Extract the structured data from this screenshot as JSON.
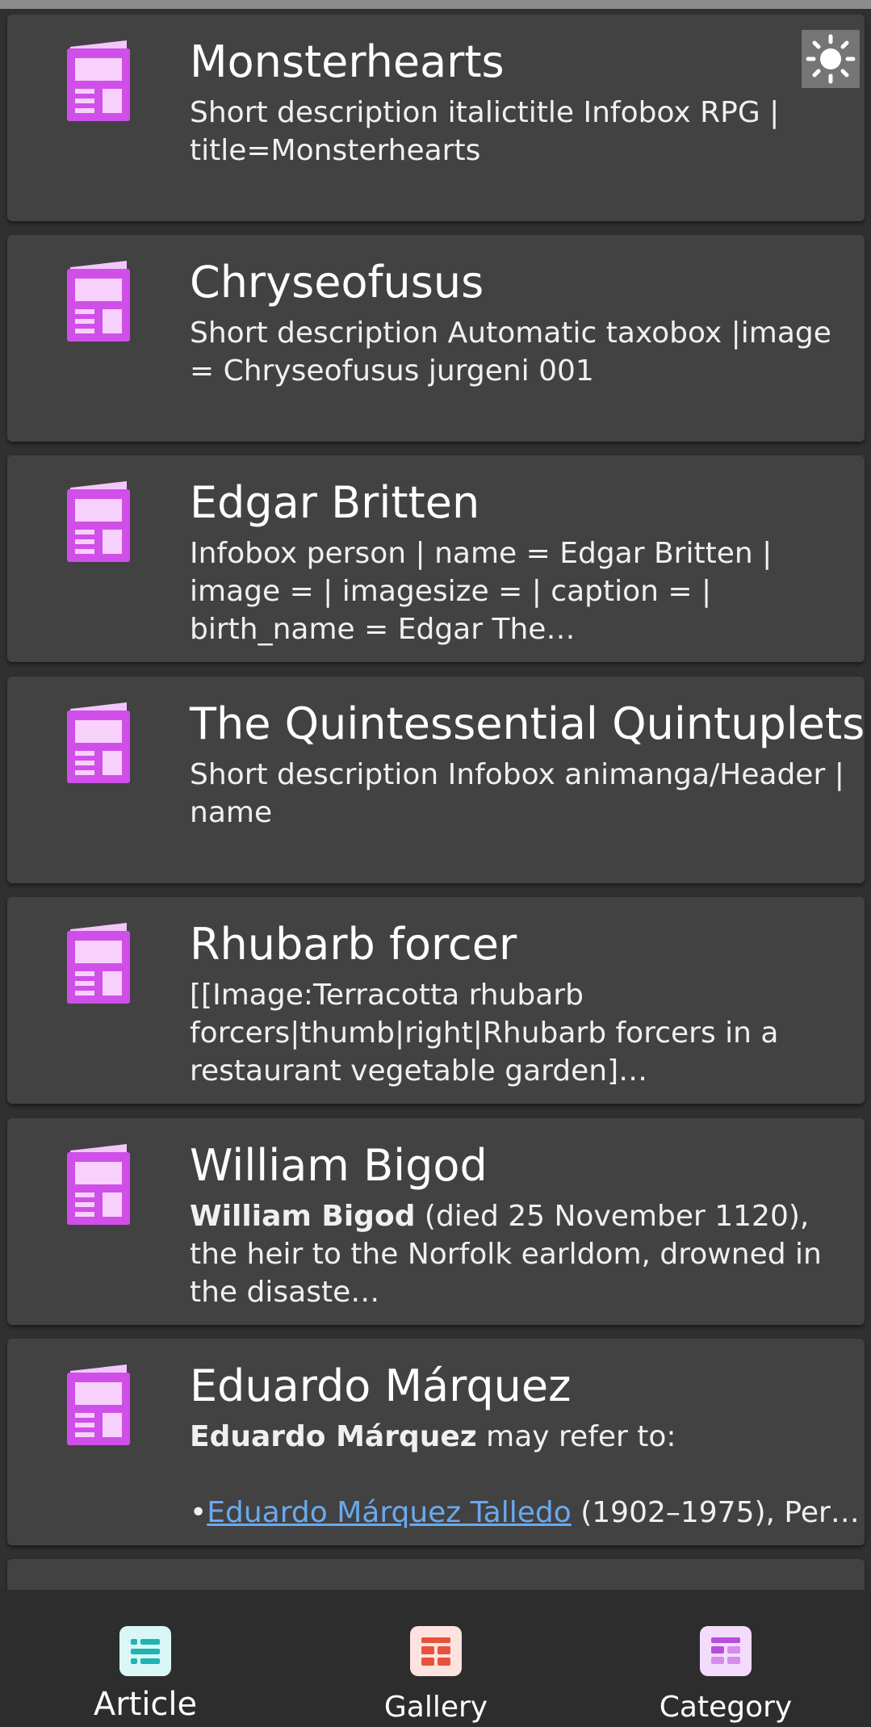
{
  "theme_toggle_icon": "sun-icon",
  "articles": [
    {
      "title": "Monsterhearts",
      "description": "Short description italictitle Infobox RPG | title=Monsterhearts"
    },
    {
      "title": "Chryseofusus",
      "description": "Short description Automatic taxobox |image = Chryseofusus jurgeni 001"
    },
    {
      "title": "Edgar Britten",
      "description": "Infobox person | name = Edgar Britten | image = | imagesize = | caption = | birth_name = Edgar The…"
    },
    {
      "title": "The Quintessential Quintuplets",
      "description": "Short description Infobox animanga/Header | name"
    },
    {
      "title": "Rhubarb forcer",
      "description": "[[Image:Terracotta rhubarb forcers|thumb|right|Rhubarb forcers in a restaurant vegetable garden]…"
    },
    {
      "title": "William Bigod",
      "description_bold": "William Bigod",
      "description_rest": " (died 25 November 1120), the heir to the Norfolk earldom, drowned in the disaste…"
    },
    {
      "title": "Eduardo Márquez",
      "description_bold": "Eduardo Márquez",
      "description_rest": " may refer to:",
      "bullet": "•",
      "link_text": "Eduardo Márquez Talledo",
      "link_rest": " (1902–1975), Per…"
    }
  ],
  "bottom_nav": [
    {
      "label": "Article",
      "icon": "article-icon",
      "active": true
    },
    {
      "label": "Gallery",
      "icon": "gallery-icon",
      "active": false
    },
    {
      "label": "Category",
      "icon": "category-icon",
      "active": false
    }
  ],
  "colors": {
    "background": "#303030",
    "card": "#424242",
    "doc_icon": "#d65ff0",
    "link": "#6aa9ef",
    "nav_article": "#1fb3b3",
    "nav_gallery": "#e8523c",
    "nav_category": "#b84de0"
  }
}
